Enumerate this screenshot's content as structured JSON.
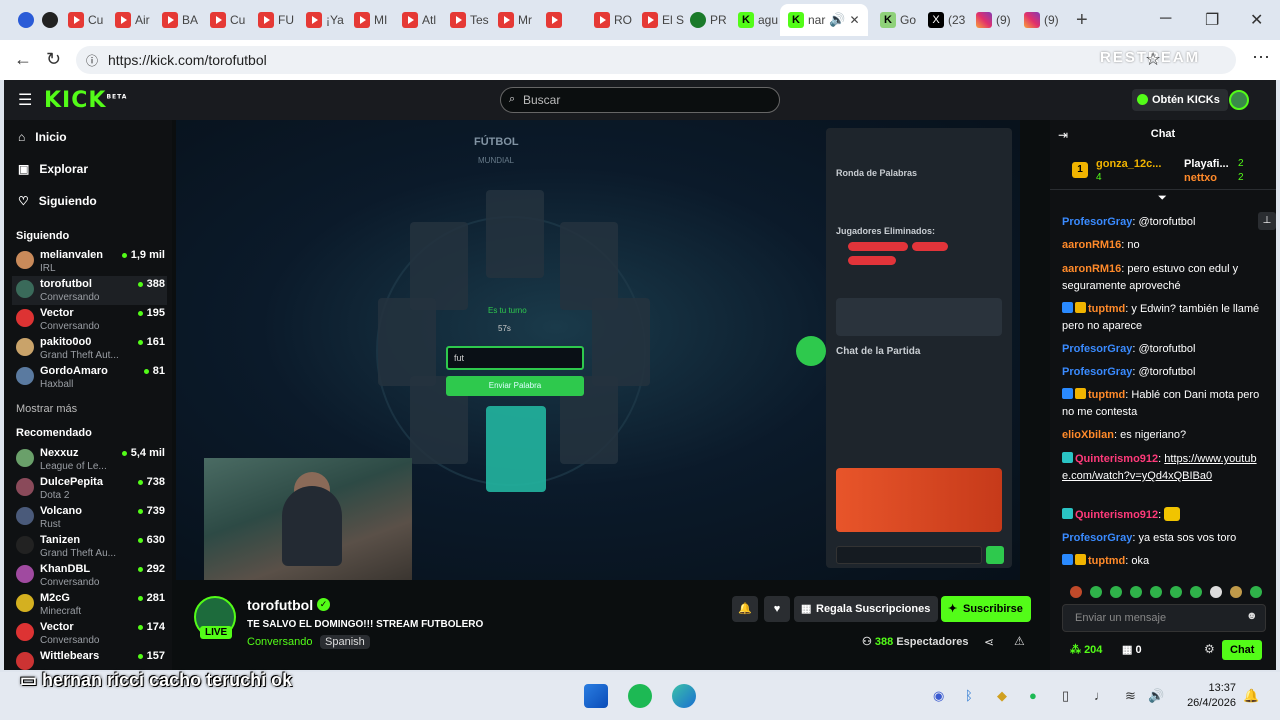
{
  "browser": {
    "tabs": [
      {
        "icon": "reddit-icon",
        "title": ""
      },
      {
        "icon": "circle-icon",
        "title": ""
      },
      {
        "icon": "youtube-icon",
        "title": "Cu"
      },
      {
        "icon": "youtube-icon",
        "title": "Air"
      },
      {
        "icon": "youtube-icon",
        "title": "BA"
      },
      {
        "icon": "youtube-icon",
        "title": "Cu"
      },
      {
        "icon": "youtube-icon",
        "title": "FU"
      },
      {
        "icon": "youtube-icon",
        "title": "¡Ya"
      },
      {
        "icon": "youtube-icon",
        "title": "MI"
      },
      {
        "icon": "youtube-icon",
        "title": "Atl"
      },
      {
        "icon": "youtube-icon",
        "title": "Tes"
      },
      {
        "icon": "youtube-icon",
        "title": "Mr"
      },
      {
        "icon": "youtube-icon",
        "title": ""
      },
      {
        "icon": "youtube-icon",
        "title": "RO"
      },
      {
        "icon": "youtube-icon",
        "title": "El S"
      },
      {
        "icon": "soccer-icon",
        "title": "PR"
      },
      {
        "icon": "kick-icon",
        "title": "agu"
      },
      {
        "icon": "kick-icon",
        "title": "nar"
      },
      {
        "icon": "kick-icon",
        "title": "Go"
      },
      {
        "icon": "x-icon",
        "title": "(23"
      },
      {
        "icon": "instagram-icon",
        "title": "(9)"
      },
      {
        "icon": "instagram-icon",
        "title": "(9)"
      }
    ],
    "url": "https://kick.com/torofutbol",
    "watermark": "RESTREAM"
  },
  "kick": {
    "logo": "KICK",
    "logo_tag": "BETA",
    "search_placeholder": "Buscar",
    "get_kicks": "Obtén KICKs"
  },
  "sidebar": {
    "nav": [
      "Inicio",
      "Explorar",
      "Siguiendo"
    ],
    "following_header": "Siguiendo",
    "following": [
      {
        "name": "melianvalen",
        "category": "IRL",
        "viewers": "1,9 mil"
      },
      {
        "name": "torofutbol",
        "category": "Conversando",
        "viewers": "388"
      },
      {
        "name": "Vector",
        "category": "Conversando",
        "viewers": "195"
      },
      {
        "name": "pakito0o0",
        "category": "Grand Theft Aut...",
        "viewers": "161"
      },
      {
        "name": "GordoAmaro",
        "category": "Haxball",
        "viewers": "81"
      }
    ],
    "show_more": "Mostrar más",
    "recommended_header": "Recomendado",
    "recommended": [
      {
        "name": "Nexxuz",
        "category": "League of Le...",
        "viewers": "5,4 mil"
      },
      {
        "name": "DulcePepita",
        "category": "Dota 2",
        "viewers": "738"
      },
      {
        "name": "Volcano",
        "category": "Rust",
        "viewers": "739"
      },
      {
        "name": "Tanizen",
        "category": "Grand Theft Au...",
        "viewers": "630"
      },
      {
        "name": "KhanDBL",
        "category": "Conversando",
        "viewers": "292"
      },
      {
        "name": "M2cG",
        "category": "Minecraft",
        "viewers": "281"
      },
      {
        "name": "Vector",
        "category": "Conversando",
        "viewers": "174"
      },
      {
        "name": "Wittlebears",
        "category": "",
        "viewers": "157"
      }
    ]
  },
  "video": {
    "game_title": "FÚTBOL",
    "game_subtitle": "MUNDIAL",
    "panel_title": "Ronda de Palabras",
    "eliminated_label": "Jugadores Eliminados:",
    "chat_label": "Chat de la Partida",
    "turn_text": "Es tu turno",
    "timer": "57s",
    "input_value": "fut",
    "submit_label": "Enviar Palabra"
  },
  "stream": {
    "streamer": "torofutbol",
    "live": "LIVE",
    "title": "TE SALVO EL DOMINGO!!! STREAM FUTBOLERO",
    "category": "Conversando",
    "language": "Spanish",
    "gift_label": "Regala Suscripciones",
    "subscribe_label": "Suscribirse",
    "viewers_count": "388",
    "viewers_label": "Espectadores"
  },
  "chat": {
    "title": "Chat",
    "leaderboard": [
      {
        "rank": "1",
        "name": "gonza_12c...",
        "count": "4"
      },
      {
        "name": "Playafi...",
        "count": "2"
      },
      {
        "name": "nettxo",
        "count": "2"
      }
    ],
    "messages": [
      {
        "user": "ProfesorGray",
        "color": "blue",
        "text": "@torofutbol"
      },
      {
        "user": "aaronRM16",
        "color": "orange",
        "text": "no"
      },
      {
        "user": "aaronRM16",
        "color": "orange",
        "text": "pero estuvo con edul y seguramente aproveché"
      },
      {
        "user": "tuptmd",
        "color": "orange",
        "text": "y Edwin? también le llamé pero no aparece"
      },
      {
        "user": "ProfesorGray",
        "color": "blue",
        "text": "@torofutbol"
      },
      {
        "user": "ProfesorGray",
        "color": "blue",
        "text": "@torofutbol"
      },
      {
        "user": "tuptmd",
        "color": "orange",
        "text": "Hablé con Dani mota pero no me contesta"
      },
      {
        "user": "elioXbilan",
        "color": "orange",
        "text": "es nigeriano?"
      },
      {
        "user": "Quinterismo912",
        "color": "pink",
        "text": "https://www.youtube.com/watch?v=yQd4xQBIBa0"
      },
      {
        "user": "Quinterismo912",
        "color": "pink",
        "text": ""
      },
      {
        "user": "ProfesorGray",
        "color": "blue",
        "text": "ya esta sos vos toro"
      },
      {
        "user": "tuptmd",
        "color": "orange",
        "text": "oka"
      }
    ],
    "input_placeholder": "Enviar un mensaje",
    "kicks_count": "204",
    "gifts_count": "0",
    "send_label": "Chat"
  },
  "overlay": {
    "subtitle": "hernan ricci cacho teruchi ok"
  },
  "taskbar": {
    "time": "13:37",
    "date": "26/4/2026"
  },
  "colors": {
    "kick_green": "#53fc18",
    "bg_dark": "#0b0e0f",
    "panel": "#191b1f",
    "user_blue": "#3a8bff",
    "user_orange": "#ff8a2a",
    "user_pink": "#ff3a7a"
  }
}
